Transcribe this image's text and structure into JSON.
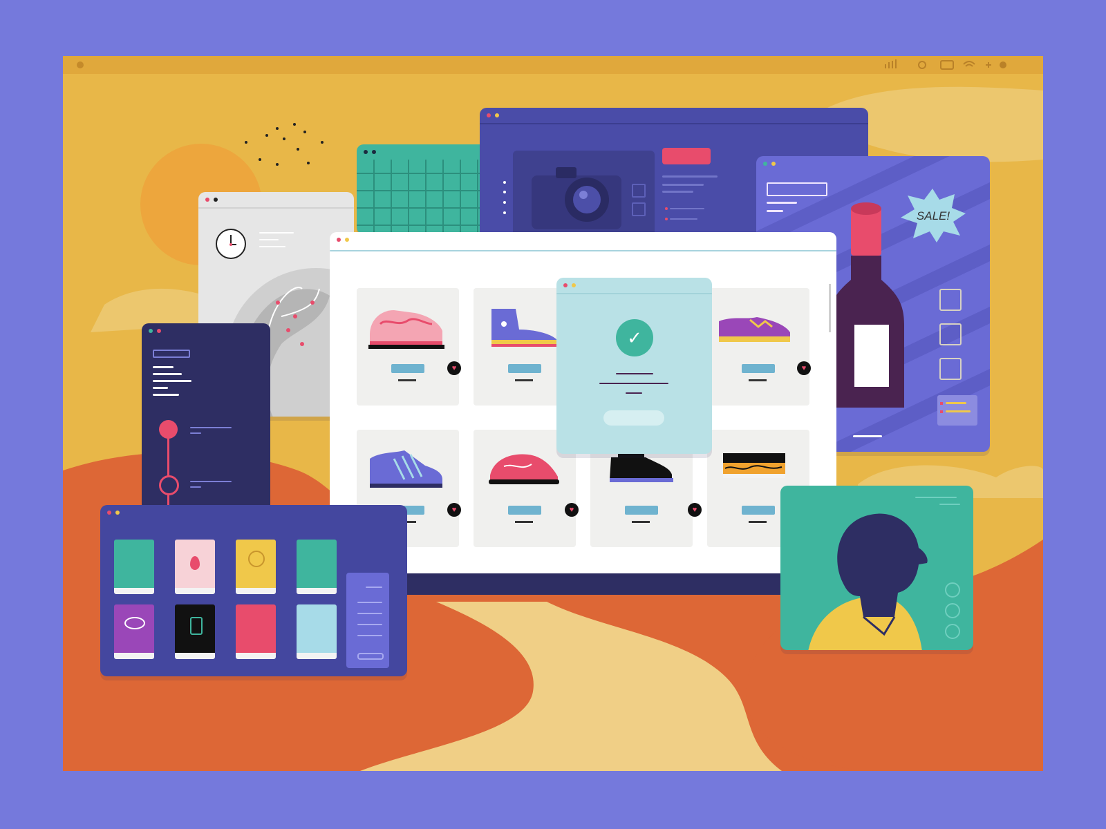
{
  "scene": {
    "sale_badge": "SALE!",
    "heart_glyph": "♥",
    "checkmark_glyph": "✓",
    "colors": {
      "background": "#7579dc",
      "sand": "#e8b748",
      "dune": "#dd6736",
      "navy": "#44479f",
      "teal": "#3fb59e",
      "accent_red": "#e84c6c"
    }
  },
  "windows": [
    {
      "name": "shop-window",
      "content": "product-grid",
      "products": 8,
      "wishlist_hearts": 5
    },
    {
      "name": "confirmation-dialog",
      "icon": "check-circle-icon"
    },
    {
      "name": "camera-window",
      "icon": "camera-icon"
    },
    {
      "name": "wine-window",
      "icon": "wine-bottle-icon"
    },
    {
      "name": "globe-window",
      "icons": [
        "clock-icon",
        "globe-icon"
      ]
    },
    {
      "name": "timeline-window"
    },
    {
      "name": "library-window",
      "books": 8
    },
    {
      "name": "profile-window",
      "icon": "avatar-icon"
    },
    {
      "name": "grid-window"
    }
  ]
}
